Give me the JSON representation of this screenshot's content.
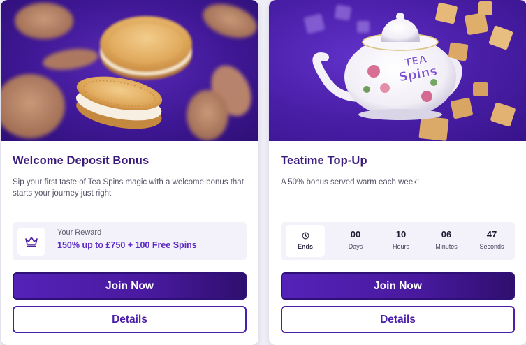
{
  "cards": [
    {
      "title": "Welcome Deposit Bonus",
      "description": "Sip your first taste of Tea Spins magic with a welcome bonus that starts your journey just right",
      "image": "biscuits-image",
      "reward": {
        "icon": "crown-icon",
        "label": "Your Reward",
        "value": "150% up to £750 + 100 Free Spins"
      },
      "join_label": "Join Now",
      "details_label": "Details"
    },
    {
      "title": "Teatime Top-Up",
      "description": "A 50% bonus served warm each week!",
      "image": "teapot-image",
      "teapot_logo_text": "TEA Spins",
      "countdown": {
        "icon": "clock-icon",
        "ends_label": "Ends",
        "days": "00",
        "days_label": "Days",
        "hours": "10",
        "hours_label": "Hours",
        "minutes": "06",
        "minutes_label": "Minutes",
        "seconds": "47",
        "seconds_label": "Seconds"
      },
      "join_label": "Join Now",
      "details_label": "Details"
    }
  ],
  "colors": {
    "brand_purple": "#4b1fa8",
    "title_purple": "#3a1a7a",
    "reward_purple": "#5b2bc4"
  }
}
